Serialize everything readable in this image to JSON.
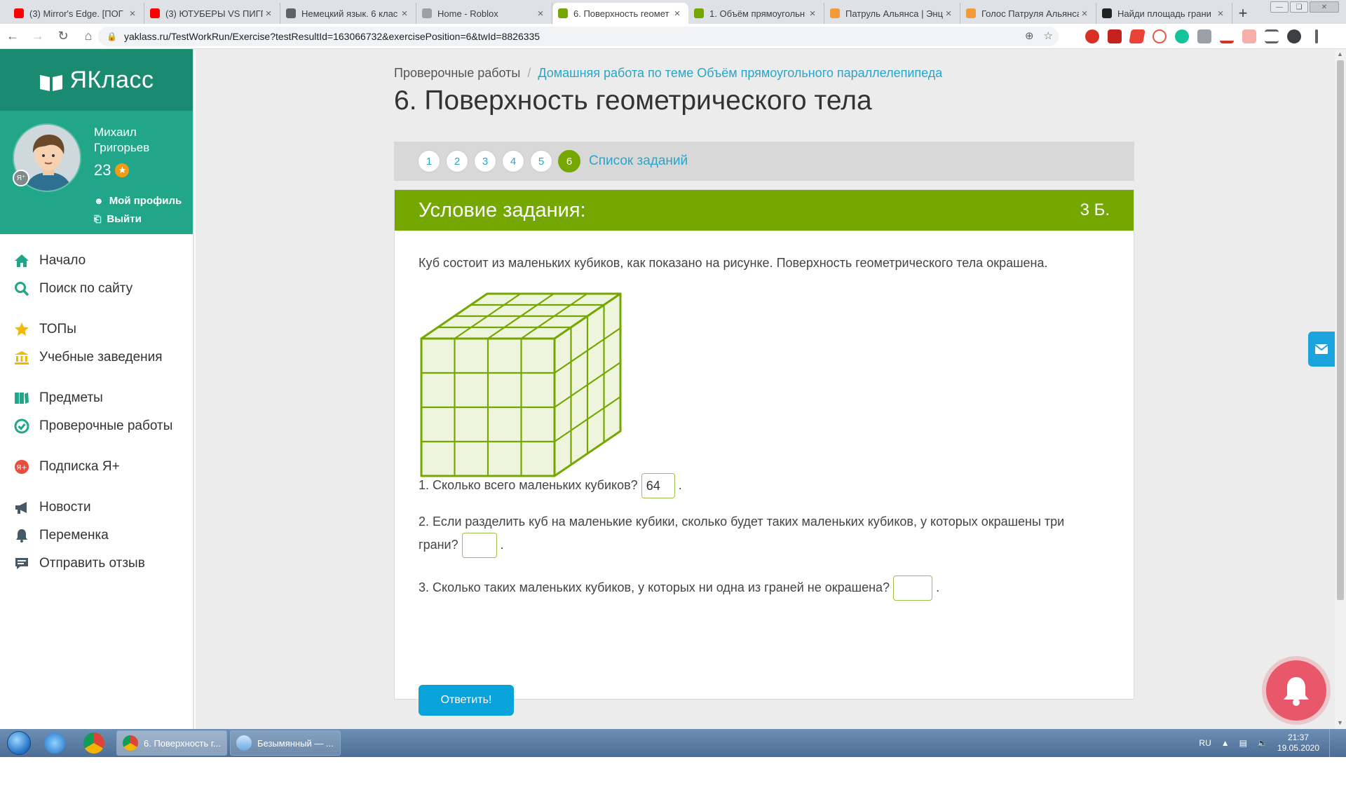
{
  "browser": {
    "tabs": [
      {
        "title": "(3) Mirror's Edge. [ПОГ",
        "icon_color": "#ff0000",
        "icon": "youtube-icon"
      },
      {
        "title": "(3) ЮТУБЕРЫ VS ПИГГ",
        "icon_color": "#ff0000",
        "icon": "youtube-icon"
      },
      {
        "title": "Немецкий язык. 6 клас",
        "icon_color": "#5f6368",
        "icon": "globe-icon"
      },
      {
        "title": "Home - Roblox",
        "icon_color": "#9aa0a6",
        "icon": "roblox-icon"
      },
      {
        "title": "6. Поверхность геомет",
        "icon_color": "#74a800",
        "icon": "yaklass-icon"
      },
      {
        "title": "1. Объём прямоугольн",
        "icon_color": "#74a800",
        "icon": "yaklass-icon"
      },
      {
        "title": "Патруль Альянса | Энц",
        "icon_color": "#f29b38",
        "icon": "fandom-icon"
      },
      {
        "title": "Голос Патруля Альянса",
        "icon_color": "#f29b38",
        "icon": "fandom-icon"
      },
      {
        "title": "Найди площадь грани",
        "icon_color": "#222222",
        "icon": "znanija-icon"
      }
    ],
    "active_tab": 4,
    "url": "yaklass.ru/TestWorkRun/Exercise?testResultId=163066732&exercisePosition=6&twId=8826335"
  },
  "sidebar": {
    "brand": "ЯКласс",
    "user": {
      "first_name": "Михаил",
      "last_name": "Григорьев",
      "points": "23",
      "profile_link": "Мой профиль",
      "logout_link": "Выйти",
      "badge": "Я⁺"
    },
    "menu": [
      [
        {
          "label": "Начало",
          "icon": "home-icon",
          "color": "#21a68a"
        },
        {
          "label": "Поиск по сайту",
          "icon": "search-icon",
          "color": "#21a68a"
        }
      ],
      [
        {
          "label": "ТОПы",
          "icon": "star-icon",
          "color": "#f5b800"
        },
        {
          "label": "Учебные заведения",
          "icon": "building-icon",
          "color": "#f5b800"
        }
      ],
      [
        {
          "label": "Предметы",
          "icon": "books-icon",
          "color": "#21a68a"
        },
        {
          "label": "Проверочные работы",
          "icon": "check-circle-icon",
          "color": "#21a68a"
        }
      ],
      [
        {
          "label": "Подписка Я+",
          "icon": "subscription-icon",
          "color": "#e74c3c"
        }
      ],
      [
        {
          "label": "Новости",
          "icon": "megaphone-icon",
          "color": "#455a64"
        },
        {
          "label": "Переменка",
          "icon": "bell-icon",
          "color": "#455a64"
        },
        {
          "label": "Отправить отзыв",
          "icon": "feedback-icon",
          "color": "#455a64"
        }
      ]
    ]
  },
  "main": {
    "breadcrumb": {
      "root": "Проверочные работы",
      "separator": "/",
      "link": "Домашняя работа по теме Объём прямоугольного параллелепипеда"
    },
    "title": "6. Поверхность геометрического тела",
    "steps": [
      "1",
      "2",
      "3",
      "4",
      "5",
      "6"
    ],
    "active_step": 5,
    "task_list_link": "Список заданий",
    "card": {
      "header": "Условие задания:",
      "points": "3 Б.",
      "condition": "Куб состоит из маленьких кубиков, как показано на рисунке. Поверхность геометрического тела окрашена.",
      "cube": {
        "size": 4,
        "face_fill": "#eef5dc",
        "stroke": "#74a800"
      },
      "questions": [
        {
          "text": "1. Сколько всего маленьких кубиков?",
          "answer": "64",
          "tail": "."
        },
        {
          "text": "2. Если разделить куб на маленькие кубики, сколько будет таких маленьких кубиков, у которых окрашены три",
          "text2": "грани?",
          "answer": "",
          "tail": "."
        },
        {
          "text": "3. Сколько таких маленьких кубиков, у которых ни одна из граней не окрашена?",
          "answer": "",
          "tail": "."
        }
      ],
      "submit_label": "Ответить!"
    }
  },
  "taskbar": {
    "tasks": [
      {
        "label": "6. Поверхность г...",
        "icon": "chrome-icon"
      },
      {
        "label": "Безымянный — ...",
        "icon": "paint-icon"
      }
    ],
    "lang": "RU",
    "time": "21:37",
    "date": "19.05.2020"
  }
}
